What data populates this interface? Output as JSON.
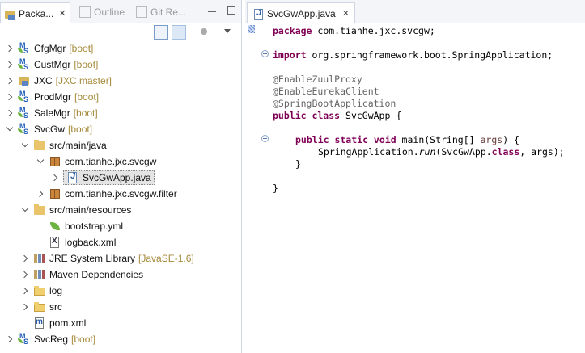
{
  "left_tabs": [
    {
      "label": "Packa...",
      "close": "✕"
    },
    {
      "label": "Outline"
    },
    {
      "label": "Git Re..."
    }
  ],
  "tree": [
    {
      "label": "CfgMgr",
      "decoration": "[boot]",
      "icon": "spring-boot-project-icon"
    },
    {
      "label": "CustMgr",
      "decoration": "[boot]",
      "icon": "spring-boot-project-icon"
    },
    {
      "label": "JXC",
      "decoration": "[JXC master]",
      "icon": "git-project-icon"
    },
    {
      "label": "ProdMgr",
      "decoration": "[boot]",
      "icon": "spring-boot-project-icon"
    },
    {
      "label": "SaleMgr",
      "decoration": "[boot]",
      "icon": "spring-boot-project-icon"
    },
    {
      "label": "SvcGw",
      "decoration": "[boot]",
      "icon": "spring-boot-project-icon"
    },
    {
      "label": "src/main/java",
      "icon": "source-folder-icon"
    },
    {
      "label": "com.tianhe.jxc.svcgw",
      "icon": "package-icon"
    },
    {
      "label": "SvcGwApp.java",
      "icon": "java-file-icon"
    },
    {
      "label": "com.tianhe.jxc.svcgw.filter",
      "icon": "package-icon"
    },
    {
      "label": "src/main/resources",
      "icon": "source-folder-icon"
    },
    {
      "label": "bootstrap.yml",
      "icon": "yml-file-icon"
    },
    {
      "label": "logback.xml",
      "icon": "xml-file-icon"
    },
    {
      "label": "JRE System Library",
      "decoration": "[JavaSE-1.6]",
      "icon": "library-icon"
    },
    {
      "label": "Maven Dependencies",
      "icon": "library-icon"
    },
    {
      "label": "log",
      "icon": "folder-icon"
    },
    {
      "label": "src",
      "icon": "folder-icon"
    },
    {
      "label": "pom.xml",
      "icon": "pom-file-icon"
    },
    {
      "label": "SvcReg",
      "decoration": "[boot]",
      "icon": "spring-boot-project-icon"
    }
  ],
  "editor": {
    "tab_label": "SvcGwApp.java",
    "tab_close": "✕",
    "code": {
      "l1_kw": "package",
      "l1_rest": " com.tianhe.jxc.svcgw;",
      "l2_kw": "import",
      "l2_rest": " org.springframework.boot.SpringApplication;",
      "l3": "@EnableZuulProxy",
      "l4": "@EnableEurekaClient",
      "l5": "@SpringBootApplication",
      "l6_kw": "public class",
      "l6_rest": " SvcGwApp {",
      "l7_kw": "public static void",
      "l7_rest": " main(String[] ",
      "l7_param": "args",
      "l7_end": ") {",
      "l8_a": "SpringApplication.",
      "l8_run": "run",
      "l8_b": "(SvcGwApp.",
      "l8_kw": "class",
      "l8_c": ", args);",
      "l9": "}",
      "l10": "}"
    }
  }
}
